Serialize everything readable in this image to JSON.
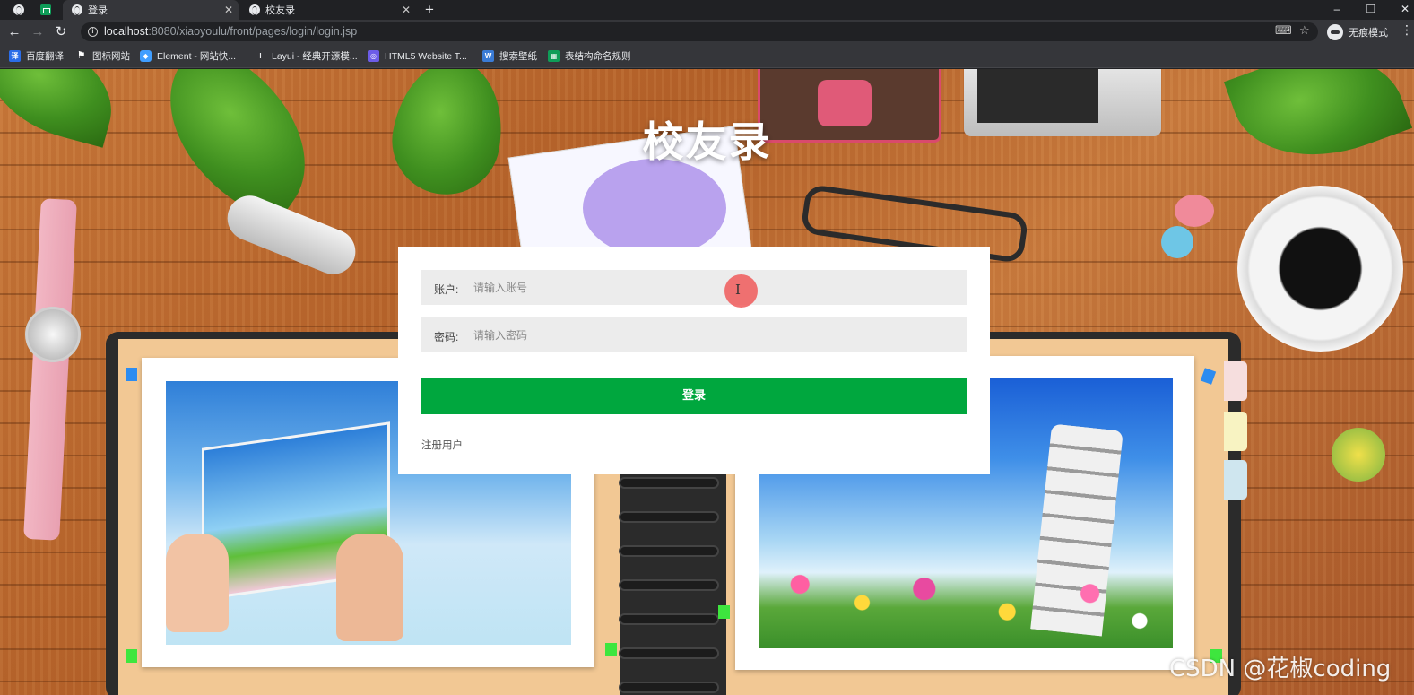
{
  "browser": {
    "tabs": [
      {
        "title": "登录",
        "active": true
      },
      {
        "title": "校友录",
        "active": false
      }
    ],
    "new_tab": "+",
    "window_controls": {
      "minimize": "–",
      "restore": "❐",
      "close": "✕"
    },
    "url_host": "localhost",
    "url_rest": ":8080/xiaoyoulu/front/pages/login/login.jsp",
    "incognito_label": "无痕模式",
    "bookmarks": [
      {
        "label": "百度翻译",
        "icon": "translate-icon",
        "color": "#2b6de8",
        "glyph": "译"
      },
      {
        "label": "图标网站",
        "icon": "flag-icon",
        "color": "#222222",
        "glyph": "⚑"
      },
      {
        "label": "Element - 网站快...",
        "icon": "element-icon",
        "color": "#409eff",
        "glyph": "◆"
      },
      {
        "label": "Layui - 经典开源模...",
        "icon": "layui-icon",
        "color": "#35363a",
        "glyph": "L"
      },
      {
        "label": "HTML5 Website T...",
        "icon": "html5-icon",
        "color": "#6c5ce7",
        "glyph": "◎"
      },
      {
        "label": "搜索壁纸",
        "icon": "wallpaper-icon",
        "color": "#3a7bd5",
        "glyph": "W"
      },
      {
        "label": "表结构命名规则",
        "icon": "sheet-icon",
        "color": "#0f9d58",
        "glyph": "▦"
      }
    ]
  },
  "page": {
    "title": "校友录",
    "form": {
      "account_label": "账户:",
      "account_placeholder": "请输入账号",
      "password_label": "密码:",
      "password_placeholder": "请输入密码",
      "login_button": "登录",
      "register_link": "注册用户"
    },
    "accent_color": "#00a73e",
    "watermark": "CSDN @花椒coding"
  }
}
